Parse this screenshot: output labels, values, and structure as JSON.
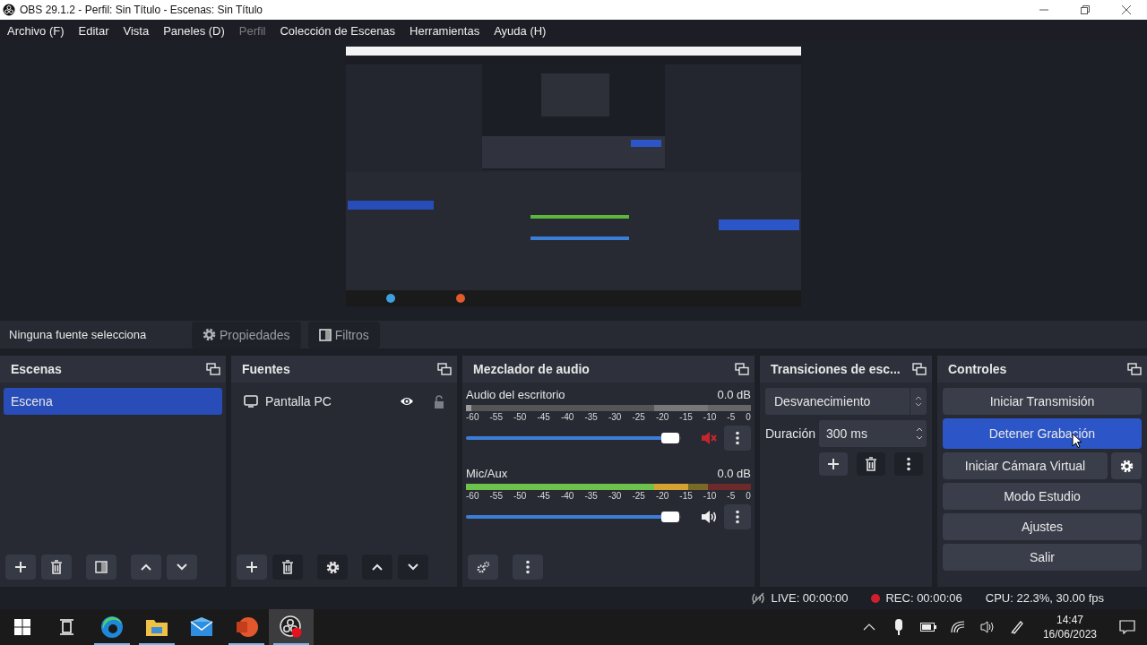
{
  "window": {
    "title": "OBS 29.1.2 - Perfil: Sin Título - Escenas: Sin Título"
  },
  "menu": [
    {
      "label": "Archivo (F)",
      "disabled": false
    },
    {
      "label": "Editar",
      "disabled": false
    },
    {
      "label": "Vista",
      "disabled": false
    },
    {
      "label": "Paneles (D)",
      "disabled": false
    },
    {
      "label": "Perfil",
      "disabled": true
    },
    {
      "label": "Colección de Escenas",
      "disabled": false
    },
    {
      "label": "Herramientas",
      "disabled": false
    },
    {
      "label": "Ayuda (H)",
      "disabled": false
    }
  ],
  "source_toolbar": {
    "status": "Ninguna fuente selecciona",
    "buttons": [
      {
        "label": "Propiedades",
        "kind": "properties",
        "disabled": true
      },
      {
        "label": "Filtros",
        "kind": "filters",
        "disabled": true
      }
    ]
  },
  "scenes": {
    "title": "Escenas",
    "items": [
      {
        "label": "Escena",
        "selected": true
      }
    ]
  },
  "sources": {
    "title": "Fuentes",
    "items": [
      {
        "label": "Pantalla PC",
        "visible": true,
        "locked": false
      }
    ]
  },
  "mixer": {
    "title": "Mezclador de audio",
    "channels": [
      {
        "name": "Audio del escritorio",
        "reading": "0.0 dB",
        "muted": true,
        "meter": {
          "level": 0.02
        },
        "volume": {
          "level": 0.95
        },
        "scale": [
          "-60",
          "-55",
          "-50",
          "-45",
          "-40",
          "-35",
          "-30",
          "-25",
          "-20",
          "-15",
          "-10",
          "-5",
          "0"
        ]
      },
      {
        "name": "Mic/Aux",
        "reading": "0.0 dB",
        "muted": false,
        "meter": {
          "level": 0.78
        },
        "volume": {
          "level": 0.95
        },
        "scale": [
          "-60",
          "-55",
          "-50",
          "-45",
          "-40",
          "-35",
          "-30",
          "-25",
          "-20",
          "-15",
          "-10",
          "-5",
          "0"
        ]
      }
    ]
  },
  "transitions": {
    "title": "Transiciones de esc...",
    "transition": "Desvanecimiento",
    "duration_label": "Duración",
    "duration": "300 ms"
  },
  "controls": {
    "title": "Controles",
    "buttons": [
      {
        "label": "Iniciar Transmisión",
        "kind": "button",
        "active": false
      },
      {
        "label": "Detener Grabación",
        "kind": "button",
        "active": true
      },
      {
        "label": "Iniciar Cámara Virtual",
        "kind": "with-settings",
        "active": false
      },
      {
        "label": "Modo Estudio",
        "kind": "button",
        "active": false
      },
      {
        "label": "Ajustes",
        "kind": "button",
        "active": false
      },
      {
        "label": "Salir",
        "kind": "button",
        "active": false
      }
    ]
  },
  "status": {
    "live": "LIVE: 00:00:00",
    "rec": "REC: 00:00:06",
    "recording": true,
    "cpu": "CPU: 22.3%, 30.00 fps"
  },
  "taskbar": {
    "apps": [
      {
        "kind": "start",
        "running": false,
        "selected": false
      },
      {
        "kind": "task-view",
        "running": false,
        "selected": false
      },
      {
        "kind": "browser",
        "running": true,
        "selected": false
      },
      {
        "kind": "folder",
        "running": true,
        "selected": false
      },
      {
        "kind": "mail",
        "running": false,
        "selected": false
      },
      {
        "kind": "slides",
        "running": true,
        "selected": false
      },
      {
        "kind": "obs",
        "running": true,
        "selected": true
      }
    ],
    "time": "14:47",
    "date": "16/06/2023"
  }
}
